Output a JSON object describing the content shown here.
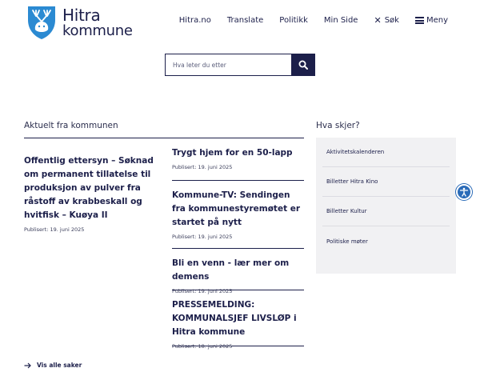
{
  "logo": {
    "line1": "Hitra",
    "line2": "kommune"
  },
  "nav": {
    "items": [
      "Hitra.no",
      "Translate",
      "Politikk",
      "Min Side"
    ],
    "search_label": "Søk",
    "menu_label": "Meny"
  },
  "search": {
    "placeholder": "Hva leter du etter"
  },
  "news": {
    "title": "Aktuelt fra kommunen",
    "featured": {
      "headline": "Offentlig ettersyn – Søknad om permanent tillatelse til produksjon av pulver fra råstoff av krabbeskall og hvitfisk – Kuøya II",
      "date": "Publisert: 19. juni 2025"
    },
    "items": [
      {
        "headline": "Trygt hjem for en 50-lapp",
        "date": "Publisert: 19. juni 2025"
      },
      {
        "headline": "Kommune-TV: Sendingen fra kommunestyremøtet er startet på nytt",
        "date": "Publisert: 19. juni 2025"
      },
      {
        "headline": "Bli en venn - lær mer om demens",
        "date": "Publisert: 19. juni 2025"
      },
      {
        "headline": "PRESSEMELDING: KOMMUNALSJEF LIVSLØP i Hitra kommune",
        "date": "Publisert: 18. juni 2025"
      }
    ],
    "more_label": "Vis alle saker"
  },
  "events": {
    "title": "Hva skjer?",
    "items": [
      "Aktivitetskalenderen",
      "Billetter Hitra Kino",
      "Billetter Kultur",
      "Politiske møter"
    ]
  },
  "colors": {
    "primary": "#1c1f4a",
    "logo_blue": "#2b8ad2",
    "accessibility": "#2a6bb8",
    "panel": "#f1f1f3"
  }
}
